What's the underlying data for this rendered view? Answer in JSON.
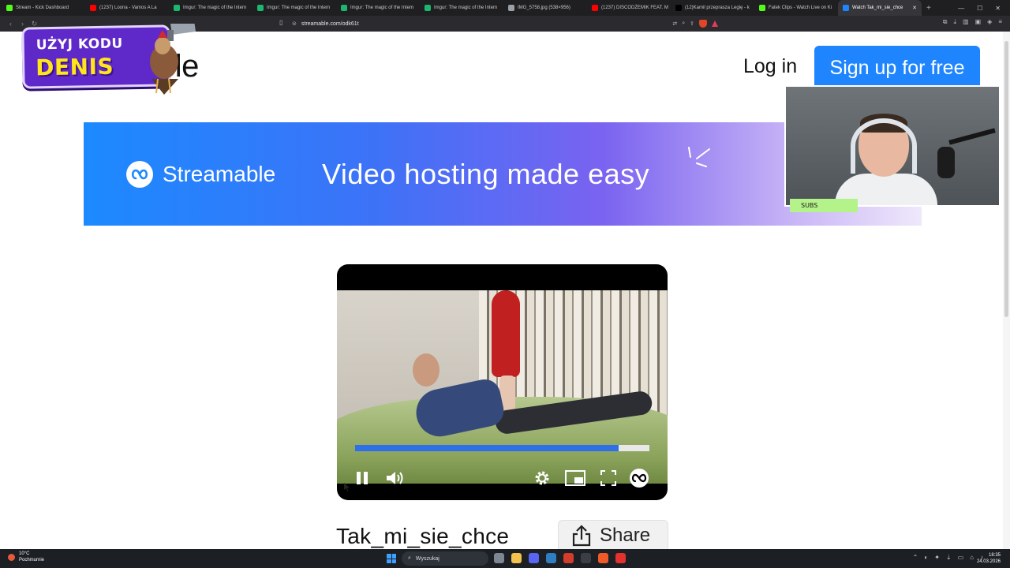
{
  "browser": {
    "tabs": [
      {
        "label": "Stream - Kick Dashboard",
        "color": "#53fc18"
      },
      {
        "label": "(1237) Loona - Vamos A La",
        "color": "#ff0000"
      },
      {
        "label": "Imgur: The magic of the Intern",
        "color": "#1bb76e"
      },
      {
        "label": "Imgur: The magic of the Intern",
        "color": "#1bb76e"
      },
      {
        "label": "Imgur: The magic of the Intern",
        "color": "#1bb76e"
      },
      {
        "label": "Imgur: The magic of the Intern",
        "color": "#1bb76e"
      },
      {
        "label": "IMG_5758.jpg (538×956)",
        "color": "#9aa0a6"
      },
      {
        "label": "(1237) DISCODŻEMIK FEAT. M",
        "color": "#ff0000"
      },
      {
        "label": "(12)Kamil przeprasza Legię - k",
        "color": "#000000"
      },
      {
        "label": "Fatek Clips - Watch Live on Ki",
        "color": "#53fc18"
      },
      {
        "label": "Watch Tak_mi_sie_chce",
        "color": "#1f85ff",
        "active": true
      }
    ],
    "new_tab": "+",
    "url": "streamable.com/odk61t"
  },
  "site": {
    "logo_text": "ble",
    "login": "Log in",
    "signup": "Sign up for free"
  },
  "promo": {
    "line1": "UŻYJ KODU",
    "line2": "DENIS"
  },
  "banner": {
    "brand": "Streamable",
    "tagline": "Video hosting made easy"
  },
  "webcam": {
    "subs_label": "SUBS"
  },
  "player": {
    "progress": 0.895,
    "controls": [
      "pause-icon",
      "volume-icon",
      "settings-gear-icon",
      "picture-in-picture-icon",
      "fullscreen-icon",
      "streamable-logo-icon"
    ]
  },
  "video": {
    "title": "Tak_mi_sie_chce",
    "share": "Share"
  },
  "taskbar": {
    "temp": "10°C",
    "weather": "Pochmurnie",
    "search": "Wyszukaj",
    "time": "18:35",
    "date": "24.03.2026"
  },
  "colors": {
    "accent": "#1f85ff",
    "progress": "#2f6fe8",
    "promo_bg": "#5f28c8",
    "promo_text": "#ffe51a"
  }
}
